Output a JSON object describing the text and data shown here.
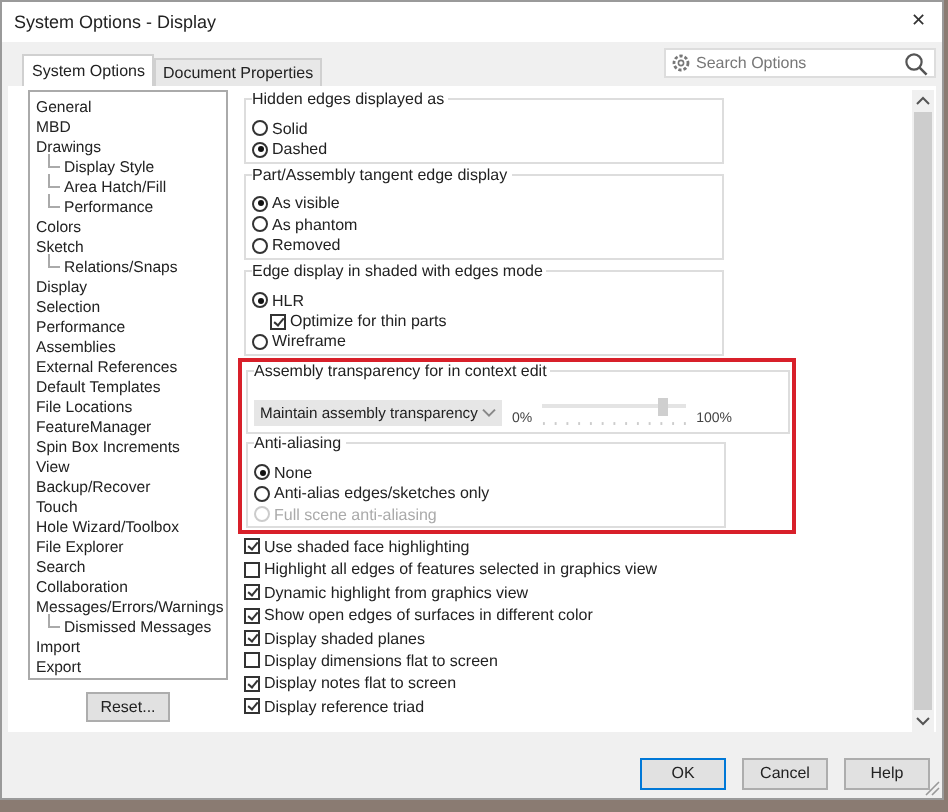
{
  "window": {
    "title": "System Options - Display",
    "close": "✕"
  },
  "tabs": [
    {
      "label": "System Options",
      "selected": true
    },
    {
      "label": "Document Properties",
      "selected": false
    }
  ],
  "search": {
    "placeholder": "Search Options"
  },
  "tree": [
    {
      "label": "General"
    },
    {
      "label": "MBD"
    },
    {
      "label": "Drawings",
      "children": [
        {
          "label": "Display Style"
        },
        {
          "label": "Area Hatch/Fill"
        },
        {
          "label": "Performance"
        }
      ]
    },
    {
      "label": "Colors"
    },
    {
      "label": "Sketch",
      "children": [
        {
          "label": "Relations/Snaps"
        }
      ]
    },
    {
      "label": "Display"
    },
    {
      "label": "Selection"
    },
    {
      "label": "Performance"
    },
    {
      "label": "Assemblies"
    },
    {
      "label": "External References"
    },
    {
      "label": "Default Templates"
    },
    {
      "label": "File Locations"
    },
    {
      "label": "FeatureManager"
    },
    {
      "label": "Spin Box Increments"
    },
    {
      "label": "View"
    },
    {
      "label": "Backup/Recover"
    },
    {
      "label": "Touch"
    },
    {
      "label": "Hole Wizard/Toolbox"
    },
    {
      "label": "File Explorer"
    },
    {
      "label": "Search"
    },
    {
      "label": "Collaboration"
    },
    {
      "label": "Messages/Errors/Warnings",
      "children": [
        {
          "label": "Dismissed Messages"
        }
      ]
    },
    {
      "label": "Import"
    },
    {
      "label": "Export"
    }
  ],
  "reset_button": "Reset...",
  "groups": [
    {
      "title": "Hidden edges displayed as",
      "options": [
        {
          "kind": "radio",
          "label": "Solid",
          "selected": false,
          "disabled": false
        },
        {
          "kind": "radio",
          "label": "Dashed",
          "selected": true,
          "disabled": false
        }
      ]
    },
    {
      "title": "Part/Assembly tangent edge display",
      "options": [
        {
          "kind": "radio",
          "label": "As visible",
          "selected": true,
          "disabled": false
        },
        {
          "kind": "radio",
          "label": "As phantom",
          "selected": false,
          "disabled": false
        },
        {
          "kind": "radio",
          "label": "Removed",
          "selected": false,
          "disabled": false
        }
      ]
    },
    {
      "title": "Edge display in shaded with edges mode",
      "options": [
        {
          "kind": "radio",
          "label": "HLR",
          "selected": true,
          "disabled": false
        },
        {
          "kind": "checkbox",
          "label": "Optimize for thin parts",
          "checked": true,
          "disabled": false
        },
        {
          "kind": "radio",
          "label": "Wireframe",
          "selected": false,
          "disabled": false
        }
      ]
    }
  ],
  "highlighted": {
    "transparency": {
      "title": "Assembly transparency for in context edit",
      "dropdown": "Maintain assembly transparency",
      "level": 0.82,
      "min_label": "0%",
      "max_label": "100%"
    },
    "antialiasing": {
      "title": "Anti-aliasing",
      "options": [
        {
          "kind": "radio",
          "label": "None",
          "selected": true,
          "disabled": false
        },
        {
          "kind": "radio",
          "label": "Anti-alias edges/sketches only",
          "selected": false,
          "disabled": false
        },
        {
          "kind": "radio",
          "label": "Full scene anti-aliasing",
          "selected": false,
          "disabled": true
        }
      ]
    }
  },
  "checkboxes": [
    {
      "label": "Use shaded face highlighting",
      "checked": true
    },
    {
      "label": "Highlight all edges of features selected in graphics view",
      "checked": false
    },
    {
      "label": "Dynamic highlight from graphics view",
      "checked": true
    },
    {
      "label": "Show open edges of surfaces in different color",
      "checked": true
    },
    {
      "label": "Display shaded planes",
      "checked": true
    },
    {
      "label": "Display dimensions flat to screen",
      "checked": false
    },
    {
      "label": "Display notes flat to screen",
      "checked": true
    },
    {
      "label": "Display reference triad",
      "checked": true
    }
  ],
  "buttons": [
    {
      "label": "OK",
      "default": true
    },
    {
      "label": "Cancel",
      "default": false
    },
    {
      "label": "Help",
      "default": false
    }
  ]
}
